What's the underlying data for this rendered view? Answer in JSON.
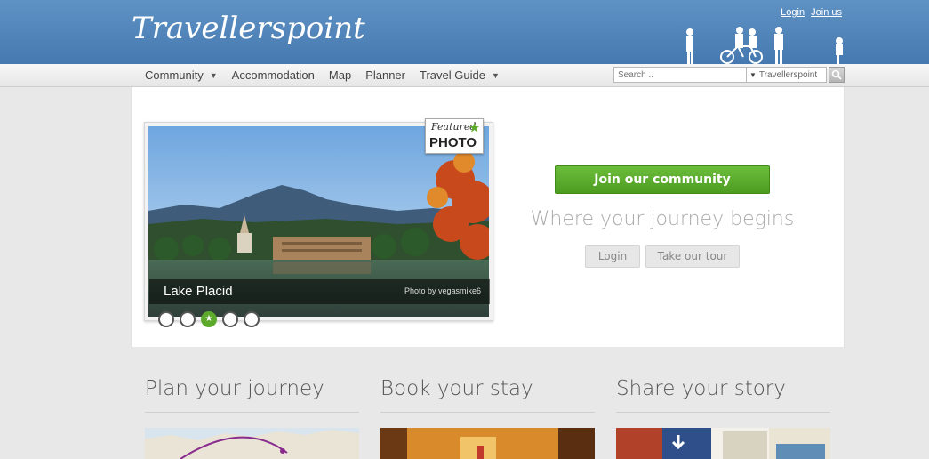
{
  "header": {
    "logo": "Travellerspoint",
    "login_link": "Login",
    "join_link": "Join us"
  },
  "nav": {
    "items": [
      {
        "label": "Community",
        "has_caret": true
      },
      {
        "label": "Accommodation"
      },
      {
        "label": "Map"
      },
      {
        "label": "Planner"
      },
      {
        "label": "Travel Guide",
        "has_caret": true
      }
    ]
  },
  "search": {
    "placeholder": "Search ..",
    "scope": "Travellerspoint",
    "icon": "magnifier-icon"
  },
  "featured": {
    "badge_word": "Featured",
    "badge_label": "PHOTO",
    "title": "Lake Placid",
    "credit": "Photo by vegasmike6",
    "dots": 5,
    "active_dot": 3
  },
  "hero": {
    "join_button": "Join our community",
    "tagline": "Where your journey begins",
    "login_button": "Login",
    "tour_button": "Take our tour"
  },
  "columns": [
    {
      "title": "Plan your journey"
    },
    {
      "title": "Book your stay"
    },
    {
      "title": "Share your story"
    }
  ],
  "colors": {
    "header_blue": "#4f84bb",
    "join_green": "#5da92b",
    "tagline_grey": "#a9a9a9"
  }
}
